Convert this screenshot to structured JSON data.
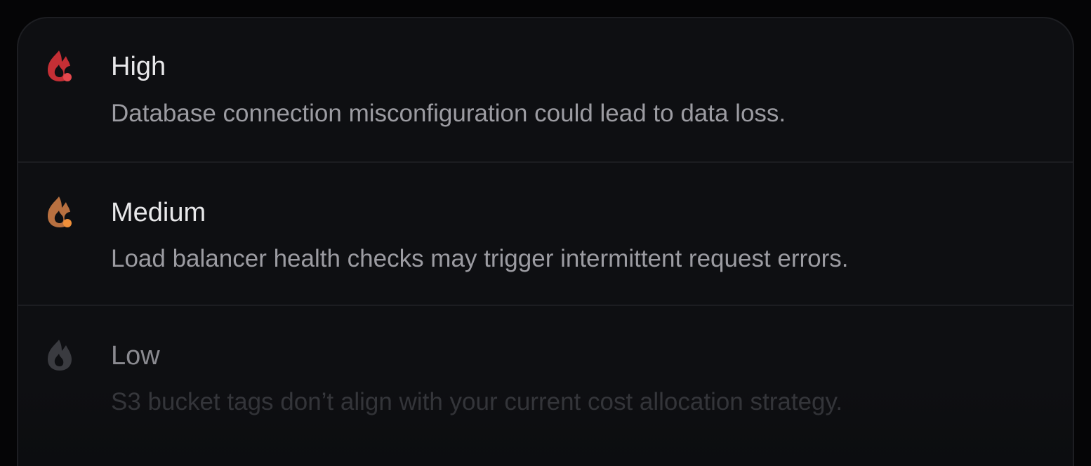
{
  "alerts": [
    {
      "severity": "High",
      "description": "Database connection misconfiguration could lead to data loss.",
      "icon": "flame-alert-icon",
      "color": "#c42f35",
      "dot_color": "#e5484d"
    },
    {
      "severity": "Medium",
      "description": "Load balancer health checks may trigger intermittent request errors.",
      "icon": "flame-alert-icon",
      "color": "#b87040",
      "dot_color": "#f0903a"
    },
    {
      "severity": "Low",
      "description": "S3 bucket tags don’t align with your current cost allocation strategy.",
      "icon": "flame-icon",
      "color": "#3a3b40"
    }
  ]
}
